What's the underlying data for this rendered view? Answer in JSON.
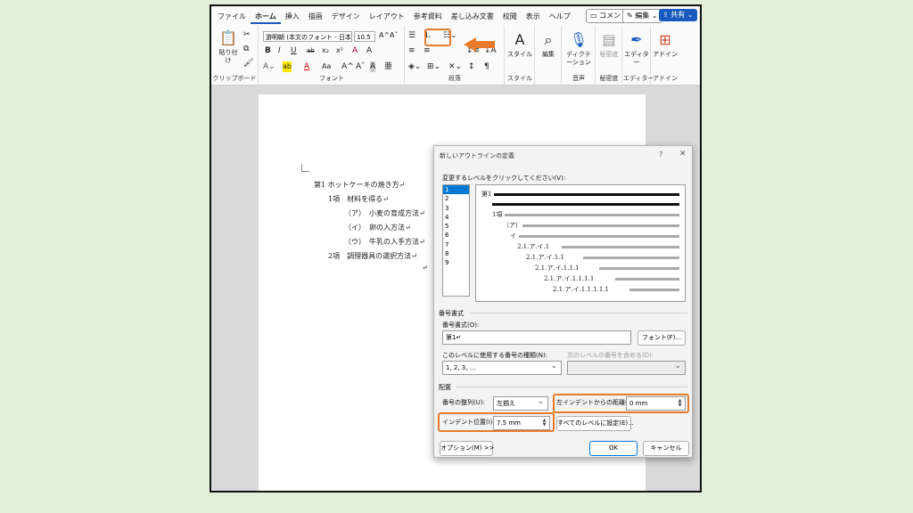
{
  "ribbon": {
    "tabs": [
      "ファイル",
      "ホーム",
      "挿入",
      "描画",
      "デザイン",
      "レイアウト",
      "参考資料",
      "差し込み文書",
      "校閲",
      "表示",
      "ヘルプ"
    ],
    "active_tab": "ホーム",
    "comment_label": "コメント",
    "edit_label": "編集",
    "share_label": "共有",
    "clipboard": {
      "paste_label": "貼り付け",
      "group_label": "クリップボード"
    },
    "font": {
      "font_name": "游明朝 (本文のフォント - 日本語)",
      "font_size": "10.5",
      "group_label": "フォント",
      "bold": "B",
      "italic": "I",
      "underline": "U",
      "strike": "ab",
      "sub": "x₂",
      "sup": "x²",
      "clear": "A",
      "highlight": "ab",
      "color": "A",
      "case": "Aa",
      "grow": "A^",
      "shrink": "Aˇ",
      "char_border": "A",
      "ruby": "亜"
    },
    "paragraph": {
      "group_label": "段落"
    },
    "style": {
      "label": "スタイル",
      "group_label": "スタイル"
    },
    "editing": {
      "label": "編集"
    },
    "voice": {
      "label": "ディクテーション",
      "group_label": "音声"
    },
    "sensitivity": {
      "label": "秘密度",
      "group_label": "秘密度"
    },
    "editor": {
      "label": "エディター",
      "group_label": "エディター"
    },
    "addins": {
      "label": "アドイン",
      "group_label": "アドイン"
    }
  },
  "document": {
    "lines": [
      {
        "text": "第1 ホットケーキの焼き方↵",
        "level": 0
      },
      {
        "text": "1項　材料を得る↵",
        "level": 1
      },
      {
        "text": "（ア）　小麦の育成方法↵",
        "level": 2
      },
      {
        "text": "（イ）　卵の入方法↵",
        "level": 2
      },
      {
        "text": "（ウ）　牛乳の入手方法↵",
        "level": 2
      },
      {
        "text": "2項　調理器具の選択方法↵",
        "level": 1
      }
    ],
    "trailing_mark": "↵"
  },
  "dialog": {
    "title": "新しいアウトラインの定義",
    "help": "?",
    "close": "✕",
    "level_prompt": "変更するレベルをクリックしてください(V):",
    "levels": [
      "1",
      "2",
      "3",
      "4",
      "5",
      "6",
      "7",
      "8",
      "9"
    ],
    "selected_level": "1",
    "preview": {
      "level1": "第1",
      "level2": "1項",
      "level3": "（ア）",
      "level4": "イ",
      "rows": [
        "2.1.ア.イ.1",
        "2.1.ア.イ.1.1",
        "2.1.ア.イ.1.1.1",
        "2.1.ア.イ.1.1.1.1",
        "2.1.ア.イ.1.1.1.1.1"
      ]
    },
    "number_format_section": "番号書式",
    "number_format_label": "番号書式(O):",
    "number_format_value": "第1↵",
    "font_button": "フォント(F)...",
    "number_style_label": "このレベルに使用する番号の種類(N):",
    "number_style_value": "1, 2, 3, …",
    "include_level_label": "次のレベルの番号を含める(D):",
    "include_level_value": "",
    "position_section": "配置",
    "alignment_label": "番号の整列(U):",
    "alignment_value": "左揃え",
    "left_indent_label": "左インデントからの距離(A):",
    "left_indent_value": "0 mm",
    "indent_label": "インデント位置(I):",
    "indent_value": "7.5 mm",
    "set_all_button": "すべてのレベルに設定(E)...",
    "options_button": "オプション(M) >>",
    "ok_button": "OK",
    "cancel_button": "キャンセル"
  },
  "colors": {
    "highlight": "#e87b2b",
    "accent": "#185abd",
    "selection": "#0078d4",
    "background": "#e2f0d9"
  }
}
